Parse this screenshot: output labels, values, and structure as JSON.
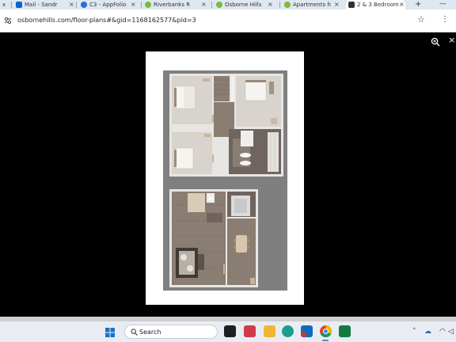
{
  "browser": {
    "tabs": [
      {
        "label": "Mail - Sandra",
        "icon": "outlook-icon",
        "color": "#0a64d6"
      },
      {
        "label": "C3 - AppFolio",
        "icon": "appfolio-icon",
        "color": "#2a6fd6"
      },
      {
        "label": "Riverbanks Re",
        "icon": "riverbanks-leaf-icon",
        "color": "#7dbb3a"
      },
      {
        "label": "Osborne Hills",
        "icon": "osborne-leaf-icon",
        "color": "#7dbb3a"
      },
      {
        "label": "Apartments fo",
        "icon": "apartments-leaf-icon",
        "color": "#7dbb3a"
      },
      {
        "label": "2 & 3 Bedroom",
        "icon": "floorplan-favicon-icon",
        "color": "#333333"
      }
    ],
    "active_tab_index": 5,
    "new_tab_symbol": "+",
    "url": "osbornehills.com/floor-plans#&gid=1168162577&pid=3"
  },
  "taskbar": {
    "search_label": "Search",
    "pinned_apps": [
      {
        "icon": "task-view-icon",
        "color": "#1f1f1f"
      },
      {
        "icon": "widgets-icon",
        "color": "#cf3b47"
      },
      {
        "icon": "file-explorer-icon",
        "color": "#f2b632"
      },
      {
        "icon": "edge-icon",
        "color": "#1a9e8c"
      },
      {
        "icon": "outlook-icon",
        "color": "#0f6cbd"
      },
      {
        "icon": "teams-icon",
        "color": "#5b5fc7"
      },
      {
        "icon": "chrome-icon",
        "color": "#db4437"
      },
      {
        "icon": "excel-icon",
        "color": "#107c41"
      }
    ]
  },
  "colors": {
    "tabstrip": "#dfe7f1",
    "viewer_background": "#000000",
    "plan_floor_wood": "#8a7d72",
    "plan_wall": "#e8e6e3",
    "plan_carpet": "#d8d3cc"
  }
}
